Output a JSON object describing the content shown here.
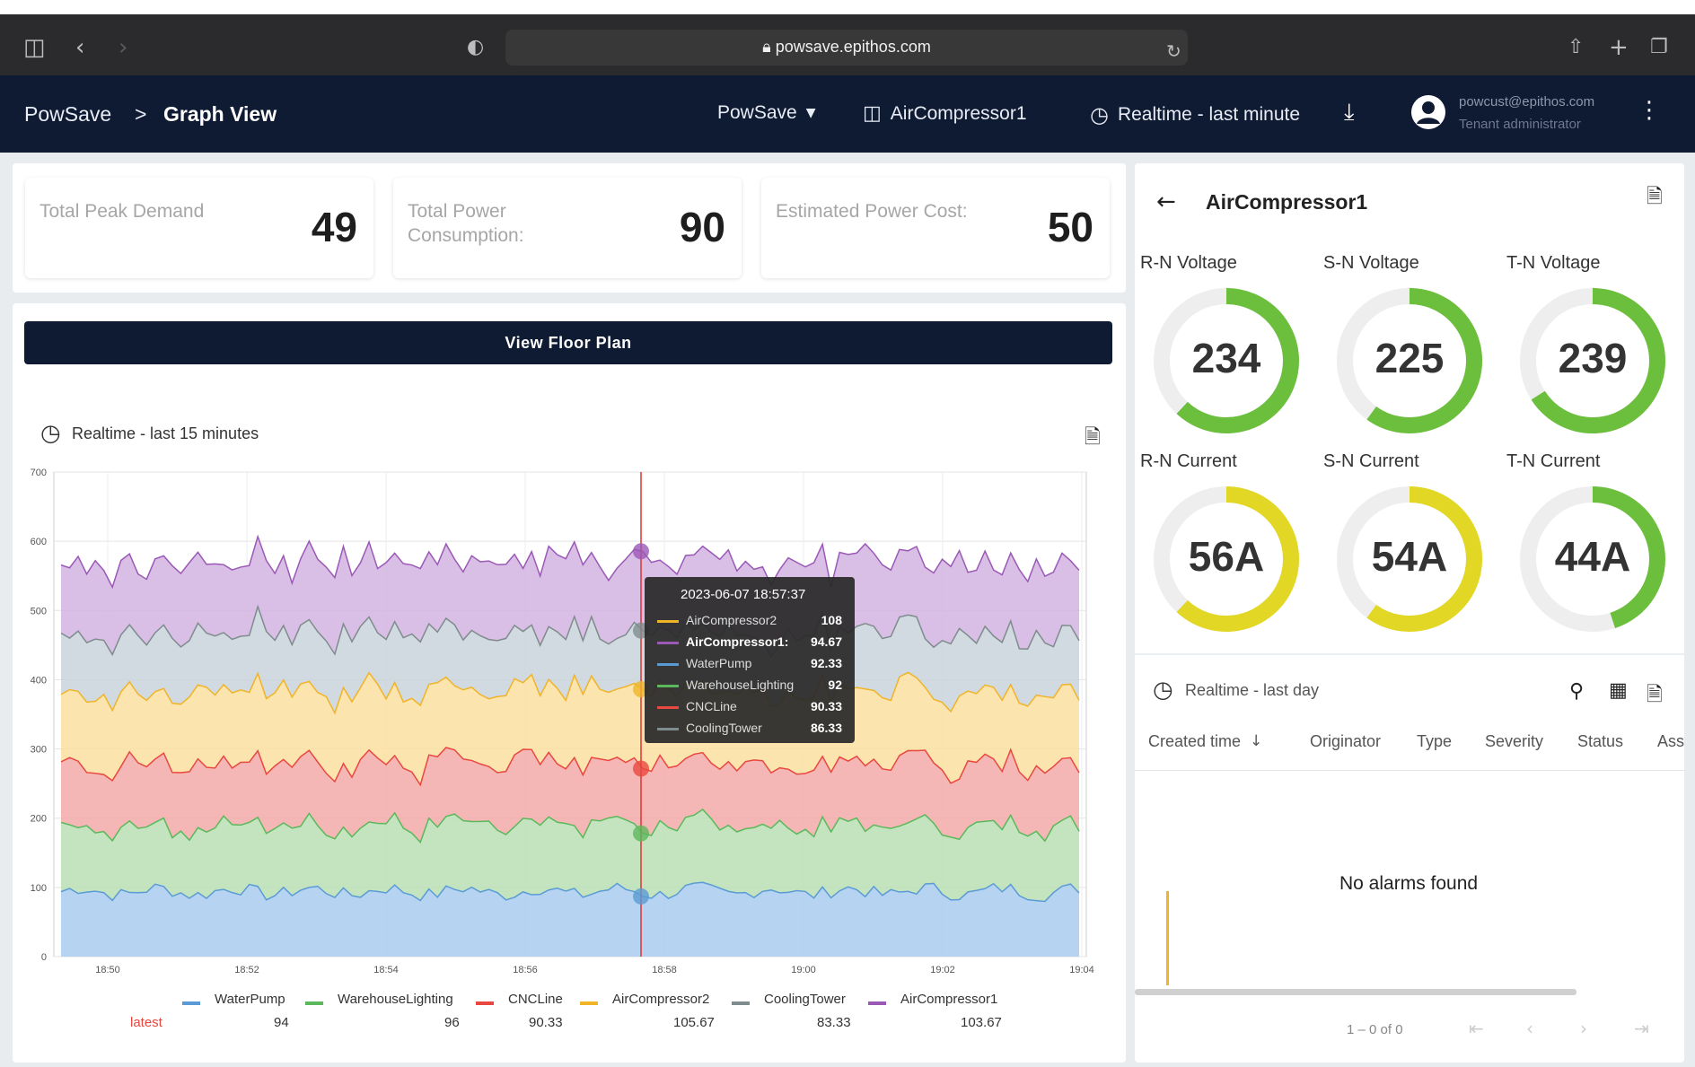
{
  "browser": {
    "url": "powsave.epithos.com"
  },
  "header": {
    "breadcrumb_root": "PowSave",
    "breadcrumb_sep": ">",
    "breadcrumb_current": "Graph View",
    "dashboard_select": "PowSave",
    "device": "AirCompressor1",
    "time_range": "Realtime - last minute",
    "user_email": "powcust@epithos.com",
    "user_role": "Tenant administrator"
  },
  "kpis": [
    {
      "label": "Total Peak Demand",
      "value": "49"
    },
    {
      "label": "Total Power Consumption:",
      "value": "90"
    },
    {
      "label": "Estimated Power Cost:",
      "value": "50"
    }
  ],
  "floor_plan_button": "View Floor Plan",
  "chart_panel": {
    "time_range": "Realtime - last 15 minutes"
  },
  "chart_data": {
    "type": "area",
    "stacked": true,
    "ylim": [
      0,
      700
    ],
    "yticks": [
      "700",
      "600",
      "500",
      "400",
      "300",
      "200",
      "100",
      "0"
    ],
    "xticks": [
      "18:50",
      "18:52",
      "18:54",
      "18:56",
      "18:58",
      "19:00",
      "19:02",
      "19:04"
    ],
    "grid": true,
    "series": [
      {
        "name": "WaterPump",
        "color": "#5b9bd5",
        "fill": "#a9cdef",
        "level": 94
      },
      {
        "name": "WarehouseLighting",
        "color": "#5cb85c",
        "fill": "#b8dfb4",
        "level": 96
      },
      {
        "name": "CNCLine",
        "color": "#e8483f",
        "fill": "#f2aaa8",
        "level": 90.33
      },
      {
        "name": "AirCompressor2",
        "color": "#f0b429",
        "fill": "#fbdfa0",
        "level": 105.67
      },
      {
        "name": "CoolingTower",
        "color": "#7f8c8d",
        "fill": "#c9d3da",
        "level": 83.33
      },
      {
        "name": "AirCompressor1",
        "color": "#9b59b6",
        "fill": "#d2b3e0",
        "level": 103.67
      }
    ],
    "cursor_x": "18:58",
    "tooltip": {
      "title": "2023-06-07 18:57:37",
      "rows": [
        {
          "name": "AirCompressor2",
          "value": "108",
          "color": "#f0b429"
        },
        {
          "name": "AirCompressor1:",
          "value": "94.67",
          "color": "#9b59b6",
          "bold": true
        },
        {
          "name": "WaterPump",
          "value": "92.33",
          "color": "#5b9bd5"
        },
        {
          "name": "WarehouseLighting",
          "value": "92",
          "color": "#5cb85c"
        },
        {
          "name": "CNCLine",
          "value": "90.33",
          "color": "#e8483f"
        },
        {
          "name": "CoolingTower",
          "value": "86.33",
          "color": "#7f8c8d"
        }
      ]
    },
    "legend": {
      "latest_label": "latest",
      "items": [
        {
          "name": "WaterPump",
          "latest": "94",
          "color": "#5b9bd5"
        },
        {
          "name": "WarehouseLighting",
          "latest": "96",
          "color": "#5cb85c"
        },
        {
          "name": "CNCLine",
          "latest": "90.33",
          "color": "#e8483f"
        },
        {
          "name": "AirCompressor2",
          "latest": "105.67",
          "color": "#f0b429"
        },
        {
          "name": "CoolingTower",
          "latest": "83.33",
          "color": "#7f8c8d"
        },
        {
          "name": "AirCompressor1",
          "latest": "103.67",
          "color": "#9b59b6"
        }
      ]
    }
  },
  "device_panel": {
    "title": "AirCompressor1",
    "gauges": [
      {
        "label": "R-N Voltage",
        "value": "234",
        "fraction": 0.62,
        "color": "#6bbf3c"
      },
      {
        "label": "S-N Voltage",
        "value": "225",
        "fraction": 0.6,
        "color": "#6bbf3c"
      },
      {
        "label": "T-N Voltage",
        "value": "239",
        "fraction": 0.66,
        "color": "#6bbf3c"
      },
      {
        "label": "R-N Current",
        "value": "56A",
        "fraction": 0.62,
        "color": "#e2d724"
      },
      {
        "label": "S-N Current",
        "value": "54A",
        "fraction": 0.6,
        "color": "#e2d724"
      },
      {
        "label": "T-N Current",
        "value": "44A",
        "fraction": 0.45,
        "color": "#6bbf3c"
      }
    ]
  },
  "alarms": {
    "time_range": "Realtime - last day",
    "columns": [
      "Created time",
      "Originator",
      "Type",
      "Severity",
      "Status",
      "Ass"
    ],
    "empty_text": "No alarms found",
    "pagination": "1 – 0 of 0"
  }
}
